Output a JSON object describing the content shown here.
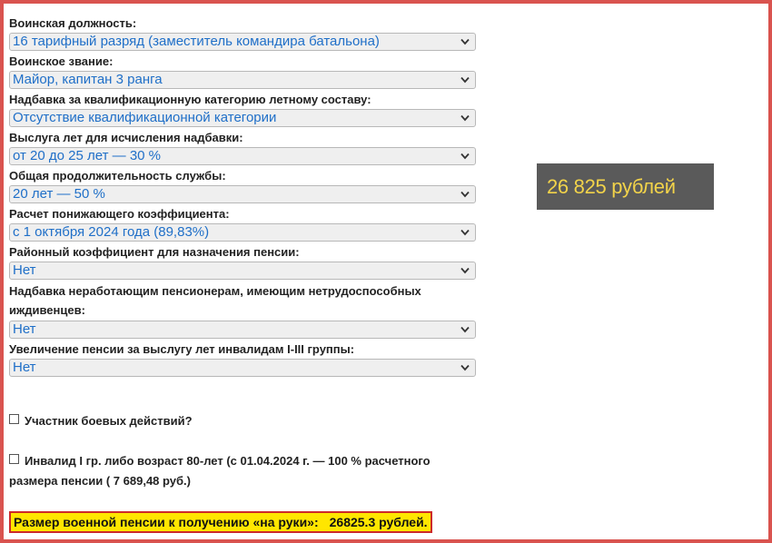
{
  "fields": [
    {
      "label": "Воинская должность:",
      "value": "16 тарифный разряд (заместитель командира батальона)"
    },
    {
      "label": "Воинское звание:",
      "value": "Майор, капитан 3 ранга"
    },
    {
      "label": "Надбавка за квалификационную категорию летному составу:",
      "value": "Отсутствие квалификационной категории"
    },
    {
      "label": "Выслуга лет для исчисления надбавки:",
      "value": "от 20 до 25 лет — 30 %"
    },
    {
      "label": "Общая продолжительность службы:",
      "value": "20 лет — 50 %"
    },
    {
      "label": "Расчет понижающего коэффициента:",
      "value": "с 1 октября 2024 года (89,83%)"
    },
    {
      "label": "Районный коэффициент для назначения пенсии:",
      "value": "Нет"
    },
    {
      "label": "Надбавка неработающим пенсионерам, имеющим нетрудоспособных иждивенцев:",
      "value": "Нет"
    },
    {
      "label": "Увеличение пенсии за выслугу лет инвалидам I-III группы:",
      "value": "Нет"
    }
  ],
  "checkboxes": {
    "combat": {
      "label": "Участник боевых действий?",
      "checked": false
    },
    "invalid": {
      "label": "Инвалид I гр. либо возраст 80-лет (с 01.04.2024 г. — 100 % расчетного размера пенсии ( 7 689,48 руб.)",
      "checked": false
    }
  },
  "result_panel": {
    "text": "26 825 рублей"
  },
  "bottom_result": {
    "label": "Размер военной пенсии к получению «на руки»:",
    "value": "26825.3 рублей."
  },
  "colors": {
    "frame": "#d9534f",
    "select_text": "#1f6fc8",
    "panel_bg": "#5a5a5a",
    "panel_text": "#f2d34a",
    "highlight": "#ffe600"
  }
}
